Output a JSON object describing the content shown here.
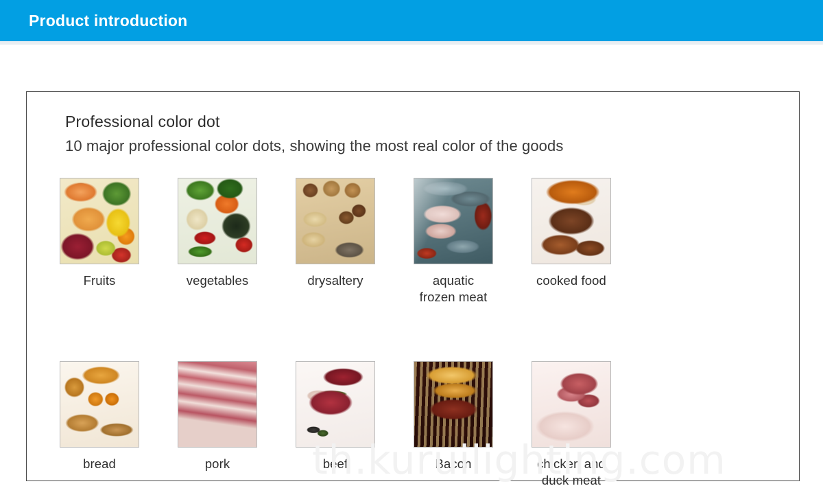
{
  "header": {
    "title": "Product introduction",
    "background_color": "#029fe3",
    "text_color": "#ffffff"
  },
  "panel": {
    "heading": "Professional color dot",
    "subheading": "10 major professional color dots, showing the most real color of the goods",
    "border_color": "#4a4a4a"
  },
  "categories": {
    "row1": [
      {
        "label": "Fruits",
        "art": "art-fruits",
        "icon": "fruits-photo"
      },
      {
        "label": "vegetables",
        "art": "art-vegetables",
        "icon": "vegetables-photo"
      },
      {
        "label": "drysaltery",
        "art": "art-drysaltery",
        "icon": "drysaltery-photo"
      },
      {
        "label": "aquatic\nfrozen meat",
        "art": "art-aquatic",
        "icon": "aquatic-frozen-meat-photo"
      },
      {
        "label": "cooked food",
        "art": "art-cookedfood",
        "icon": "cooked-food-photo"
      }
    ],
    "row2": [
      {
        "label": "bread",
        "art": "art-bread",
        "icon": "bread-photo"
      },
      {
        "label": "pork",
        "art": "art-pork",
        "icon": "pork-photo"
      },
      {
        "label": "beef",
        "art": "art-beef",
        "icon": "beef-photo"
      },
      {
        "label": "Bacon",
        "art": "art-bacon",
        "icon": "bacon-photo"
      },
      {
        "label": "chicken and\nduck meat",
        "art": "art-chickenduck",
        "icon": "chicken-and-duck-meat-photo"
      }
    ]
  },
  "watermark": {
    "text": "th.kuruilighting.com",
    "color": "#f2f2f2"
  }
}
